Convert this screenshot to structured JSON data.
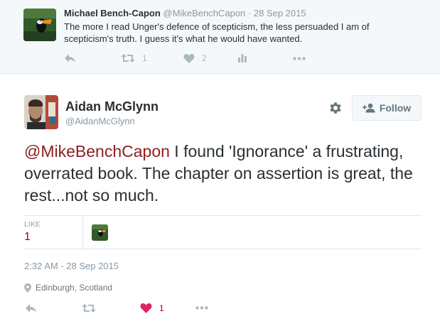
{
  "parent_tweet": {
    "name": "Michael Bench-Capon",
    "handle": "@MikeBenchCapon",
    "separator": "·",
    "date": "28 Sep 2015",
    "text": "The more I read Unger's defence of scepticism, the less persuaded I am of scepticism's truth. I guess it's what he would have wanted.",
    "retweet_count": "1",
    "like_count": "2"
  },
  "main_tweet": {
    "name": "Aidan McGlynn",
    "handle": "@AidanMcGlynn",
    "follow_label": "Follow",
    "mention": "@MikeBenchCapon",
    "text": " I found 'Ignorance' a frustrating, overrated book. The chapter on assertion is great, the rest...not so much.",
    "likes_label": "LIKE",
    "likes_count": "1",
    "timestamp": "2:32 AM - 28 Sep 2015",
    "location": "Edinburgh, Scotland",
    "action_like_count": "1"
  },
  "colors": {
    "accent_red": "#a0041e",
    "mention_color": "#8f1e1e",
    "muted": "#8899a6",
    "icon_muted": "#aab8c2"
  },
  "icons": [
    "reply-icon",
    "retweet-icon",
    "heart-icon",
    "analytics-icon",
    "more-icon",
    "gear-icon",
    "add-user-icon",
    "location-pin-icon"
  ]
}
